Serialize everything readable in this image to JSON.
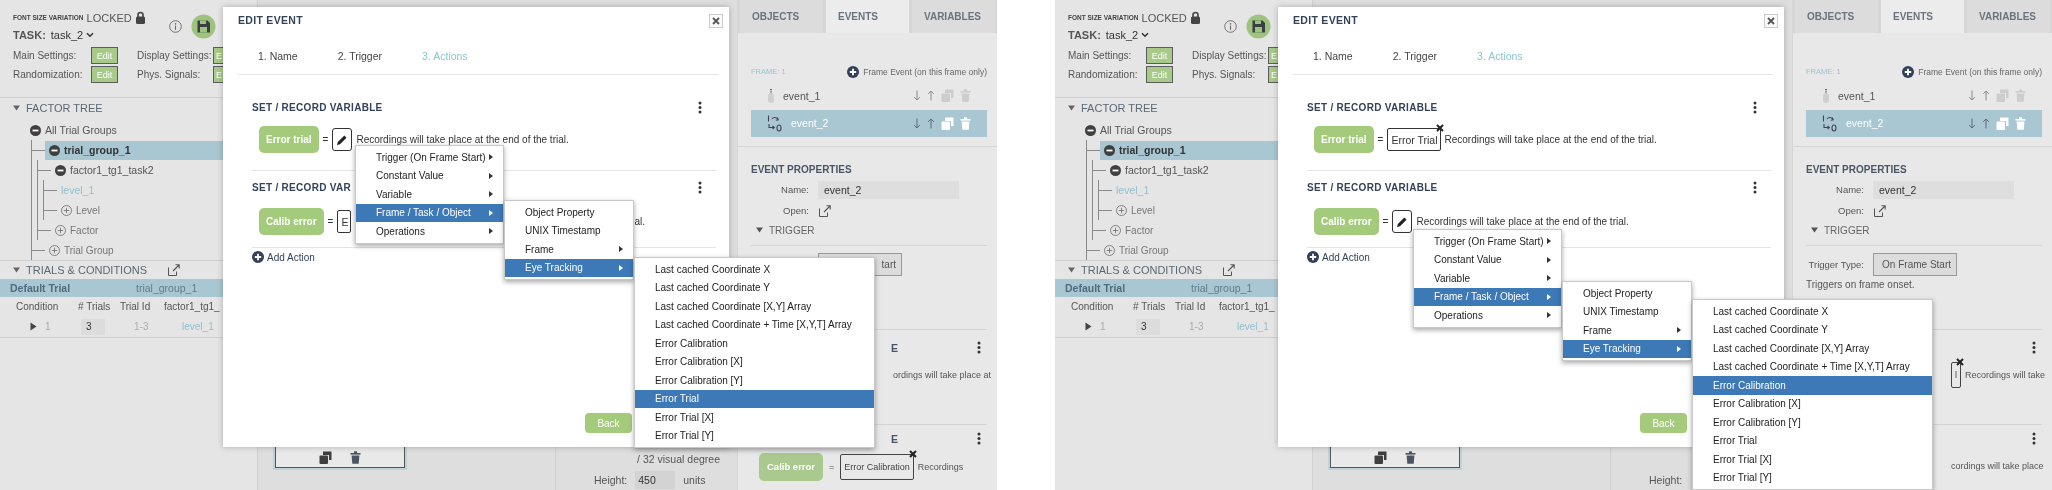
{
  "screens": [
    {
      "sidebar": {
        "font_size_label": "FONT SIZE VARIATION",
        "lock_label": "LOCKED",
        "task_label": "TASK:",
        "task_value": "task_2",
        "settings": [
          {
            "label": "Main Settings:",
            "button": "Edit"
          },
          {
            "label": "Display Settings:",
            "button": "E"
          },
          {
            "label": "Randomization:",
            "button": "Edit"
          },
          {
            "label": "Phys. Signals:",
            "button": "E"
          }
        ],
        "factor_tree": {
          "title": "FACTOR TREE",
          "expanded": true,
          "nodes": [
            {
              "kind": "group",
              "label": "All Trial Groups",
              "selected": false,
              "children": [
                {
                  "kind": "group",
                  "label": "trial_group_1",
                  "selected": true,
                  "children": [
                    {
                      "kind": "group",
                      "label": "factor1_tg1_task2",
                      "selected": false,
                      "children": [
                        {
                          "kind": "level",
                          "label": "level_1",
                          "selected": false
                        },
                        {
                          "kind": "add",
                          "label": "Level"
                        }
                      ]
                    },
                    {
                      "kind": "add",
                      "label": "Factor"
                    }
                  ]
                },
                {
                  "kind": "add",
                  "label": "Trial Group"
                }
              ]
            }
          ]
        },
        "trials": {
          "title": "TRIALS & CONDITIONS",
          "expanded": true,
          "group_row": [
            "Default Trial",
            "trial_group_1"
          ],
          "columns": [
            "Condition",
            "# Trials",
            "Trial Id",
            "factor1_tg1_"
          ],
          "rows": [
            {
              "expanded": false,
              "cells": [
                "1",
                "3",
                "1-3",
                "level_1"
              ]
            }
          ]
        }
      },
      "canvas": {
        "degree_text": "/ 32 visual degree",
        "height_label": "Height:",
        "height_value": "450",
        "height_unit": "units"
      },
      "panel": {
        "tabs": [
          {
            "label": "OBJECTS",
            "selected": false
          },
          {
            "label": "EVENTS",
            "selected": true
          },
          {
            "label": "VARIABLES",
            "selected": false
          }
        ],
        "frame_label": "FRAME: 1",
        "add_event": "Frame Event (on this frame only)",
        "events": [
          {
            "kind": "mouse",
            "name": "event_1",
            "selected": false
          },
          {
            "kind": "loop",
            "name": "event_2",
            "selected": true
          }
        ],
        "properties_title": "EVENT PROPERTIES",
        "name_label": "Name:",
        "name_value": "event_2",
        "open_label": "Open:",
        "trigger_title": "TRIGGER",
        "trigger_expanded": true,
        "trigger_button": "tart",
        "cards": [
          {
            "title": "E",
            "body": {
              "kind": "text",
              "text": "ordings will take place at"
            }
          },
          {
            "title": "E",
            "body": {
              "kind": "assignment",
              "variable": "Calib error",
              "operator": "=",
              "value": {
                "kind": "text",
                "text": "Error Calibration",
                "removable": true
              },
              "text": "Recordings"
            }
          }
        ]
      },
      "modal": {
        "title": "EDIT EVENT",
        "steps": [
          {
            "label": "1. Name",
            "selected": false
          },
          {
            "label": "2. Trigger",
            "selected": false
          },
          {
            "label": "3. Actions",
            "selected": true
          }
        ],
        "actions": [
          {
            "title": "SET / RECORD VARIABLE",
            "variable": "Error trial",
            "operator": "=",
            "value": {
              "kind": "pencil"
            },
            "text": "Recordings will take place at the end of the trial."
          },
          {
            "title": "SET / RECORD VAR",
            "variable": "Calib error",
            "operator": "=",
            "value": {
              "kind": "text",
              "text": "E",
              "removable": false
            },
            "text": "al."
          }
        ],
        "add_action": "Add Action",
        "back_button": "Back"
      },
      "menus": [
        {
          "items": [
            {
              "label": "Trigger (On Frame Start)",
              "submenu": true,
              "selected": false
            },
            {
              "label": "Constant Value",
              "submenu": true,
              "selected": false
            },
            {
              "label": "Variable",
              "submenu": true,
              "selected": false
            },
            {
              "label": "Frame / Task / Object",
              "submenu": true,
              "selected": true
            },
            {
              "label": "Operations",
              "submenu": true,
              "selected": false
            }
          ]
        },
        {
          "items": [
            {
              "label": "Object Property",
              "submenu": false,
              "selected": false
            },
            {
              "label": "UNIX Timestamp",
              "submenu": false,
              "selected": false
            },
            {
              "label": "Frame",
              "submenu": true,
              "selected": false
            },
            {
              "label": "Eye Tracking",
              "submenu": true,
              "selected": true
            }
          ]
        },
        {
          "items": [
            {
              "label": "Last cached Coordinate X",
              "submenu": false,
              "selected": false
            },
            {
              "label": "Last cached Coordinate Y",
              "submenu": false,
              "selected": false
            },
            {
              "label": "Last cached Coordinate [X,Y] Array",
              "submenu": false,
              "selected": false
            },
            {
              "label": "Last cached Coordinate + Time [X,Y,T] Array",
              "submenu": false,
              "selected": false
            },
            {
              "label": "Error Calibration",
              "submenu": false,
              "selected": false
            },
            {
              "label": "Error Calibration [X]",
              "submenu": false,
              "selected": false
            },
            {
              "label": "Error Calibration [Y]",
              "submenu": false,
              "selected": false
            },
            {
              "label": "Error Trial",
              "submenu": false,
              "selected": true
            },
            {
              "label": "Error Trial [X]",
              "submenu": false,
              "selected": false
            },
            {
              "label": "Error Trial [Y]",
              "submenu": false,
              "selected": false
            }
          ]
        }
      ]
    },
    {
      "sidebar": {
        "font_size_label": "FONT SIZE VARIATION",
        "lock_label": "LOCKED",
        "task_label": "TASK:",
        "task_value": "task_2",
        "settings": [
          {
            "label": "Main Settings:",
            "button": "Edit"
          },
          {
            "label": "Display Settings:",
            "button": "E"
          },
          {
            "label": "Randomization:",
            "button": "Edit"
          },
          {
            "label": "Phys. Signals:",
            "button": "E"
          }
        ],
        "factor_tree": {
          "title": "FACTOR TREE",
          "expanded": true,
          "nodes": [
            {
              "kind": "group",
              "label": "All Trial Groups",
              "selected": false,
              "children": [
                {
                  "kind": "group",
                  "label": "trial_group_1",
                  "selected": true,
                  "children": [
                    {
                      "kind": "group",
                      "label": "factor1_tg1_task2",
                      "selected": false,
                      "children": [
                        {
                          "kind": "level",
                          "label": "level_1",
                          "selected": false
                        },
                        {
                          "kind": "add",
                          "label": "Level"
                        }
                      ]
                    },
                    {
                      "kind": "add",
                      "label": "Factor"
                    }
                  ]
                },
                {
                  "kind": "add",
                  "label": "Trial Group"
                }
              ]
            }
          ]
        },
        "trials": {
          "title": "TRIALS & CONDITIONS",
          "expanded": true,
          "group_row": [
            "Default Trial",
            "trial_group_1"
          ],
          "columns": [
            "Condition",
            "# Trials",
            "Trial Id",
            "factor1_tg1_"
          ],
          "rows": [
            {
              "expanded": false,
              "cells": [
                "1",
                "3",
                "1-3",
                "level_1"
              ]
            }
          ]
        }
      },
      "canvas": {
        "height_label": "Height:"
      },
      "panel": {
        "tabs": [
          {
            "label": "OBJECTS",
            "selected": false
          },
          {
            "label": "EVENTS",
            "selected": true
          },
          {
            "label": "VARIABLES",
            "selected": false
          }
        ],
        "frame_label": "FRAME: 1",
        "add_event": "Frame Event (on this frame only)",
        "events": [
          {
            "kind": "mouse",
            "name": "event_1",
            "selected": false
          },
          {
            "kind": "loop",
            "name": "event_2",
            "selected": true
          }
        ],
        "properties_title": "EVENT PROPERTIES",
        "name_label": "Name:",
        "name_value": "event_2",
        "open_label": "Open:",
        "trigger_title": "TRIGGER",
        "trigger_expanded": true,
        "trigger_type_label": "Trigger Type:",
        "trigger_button": "On Frame Start",
        "trigger_note": "Triggers on frame onset.",
        "cards": [
          {
            "body": {
              "kind": "text",
              "value": {
                "kind": "text",
                "text": "l",
                "removable": true
              },
              "text": "Recordings will take"
            }
          },
          {
            "body": {
              "kind": "text",
              "text": "cordings will take place"
            }
          }
        ]
      },
      "modal": {
        "title": "EDIT EVENT",
        "steps": [
          {
            "label": "1. Name",
            "selected": false
          },
          {
            "label": "2. Trigger",
            "selected": false
          },
          {
            "label": "3. Actions",
            "selected": true
          }
        ],
        "actions": [
          {
            "title": "SET / RECORD VARIABLE",
            "variable": "Error trial",
            "operator": "=",
            "value": {
              "kind": "text",
              "text": "Error Trial",
              "removable": true
            },
            "text": "Recordings will take place at the end of the trial."
          },
          {
            "title": "SET / RECORD VARIABLE",
            "variable": "Calib error",
            "operator": "=",
            "value": {
              "kind": "pencil"
            },
            "text": "Recordings will take place at the end of the trial."
          }
        ],
        "add_action": "Add Action",
        "back_button": "Back"
      },
      "menus": [
        {
          "items": [
            {
              "label": "Trigger (On Frame Start)",
              "submenu": true,
              "selected": false
            },
            {
              "label": "Constant Value",
              "submenu": true,
              "selected": false
            },
            {
              "label": "Variable",
              "submenu": true,
              "selected": false
            },
            {
              "label": "Frame / Task / Object",
              "submenu": true,
              "selected": true
            },
            {
              "label": "Operations",
              "submenu": true,
              "selected": false
            }
          ]
        },
        {
          "items": [
            {
              "label": "Object Property",
              "submenu": false,
              "selected": false
            },
            {
              "label": "UNIX Timestamp",
              "submenu": false,
              "selected": false
            },
            {
              "label": "Frame",
              "submenu": true,
              "selected": false
            },
            {
              "label": "Eye Tracking",
              "submenu": true,
              "selected": true
            }
          ]
        },
        {
          "items": [
            {
              "label": "Last cached Coordinate X",
              "submenu": false,
              "selected": false
            },
            {
              "label": "Last cached Coordinate Y",
              "submenu": false,
              "selected": false
            },
            {
              "label": "Last cached Coordinate [X,Y] Array",
              "submenu": false,
              "selected": false
            },
            {
              "label": "Last cached Coordinate + Time [X,Y,T] Array",
              "submenu": false,
              "selected": false
            },
            {
              "label": "Error Calibration",
              "submenu": false,
              "selected": true
            },
            {
              "label": "Error Calibration [X]",
              "submenu": false,
              "selected": false
            },
            {
              "label": "Error Calibration [Y]",
              "submenu": false,
              "selected": false
            },
            {
              "label": "Error Trial",
              "submenu": false,
              "selected": false
            },
            {
              "label": "Error Trial [X]",
              "submenu": false,
              "selected": false
            },
            {
              "label": "Error Trial [Y]",
              "submenu": false,
              "selected": false
            }
          ]
        }
      ]
    }
  ]
}
